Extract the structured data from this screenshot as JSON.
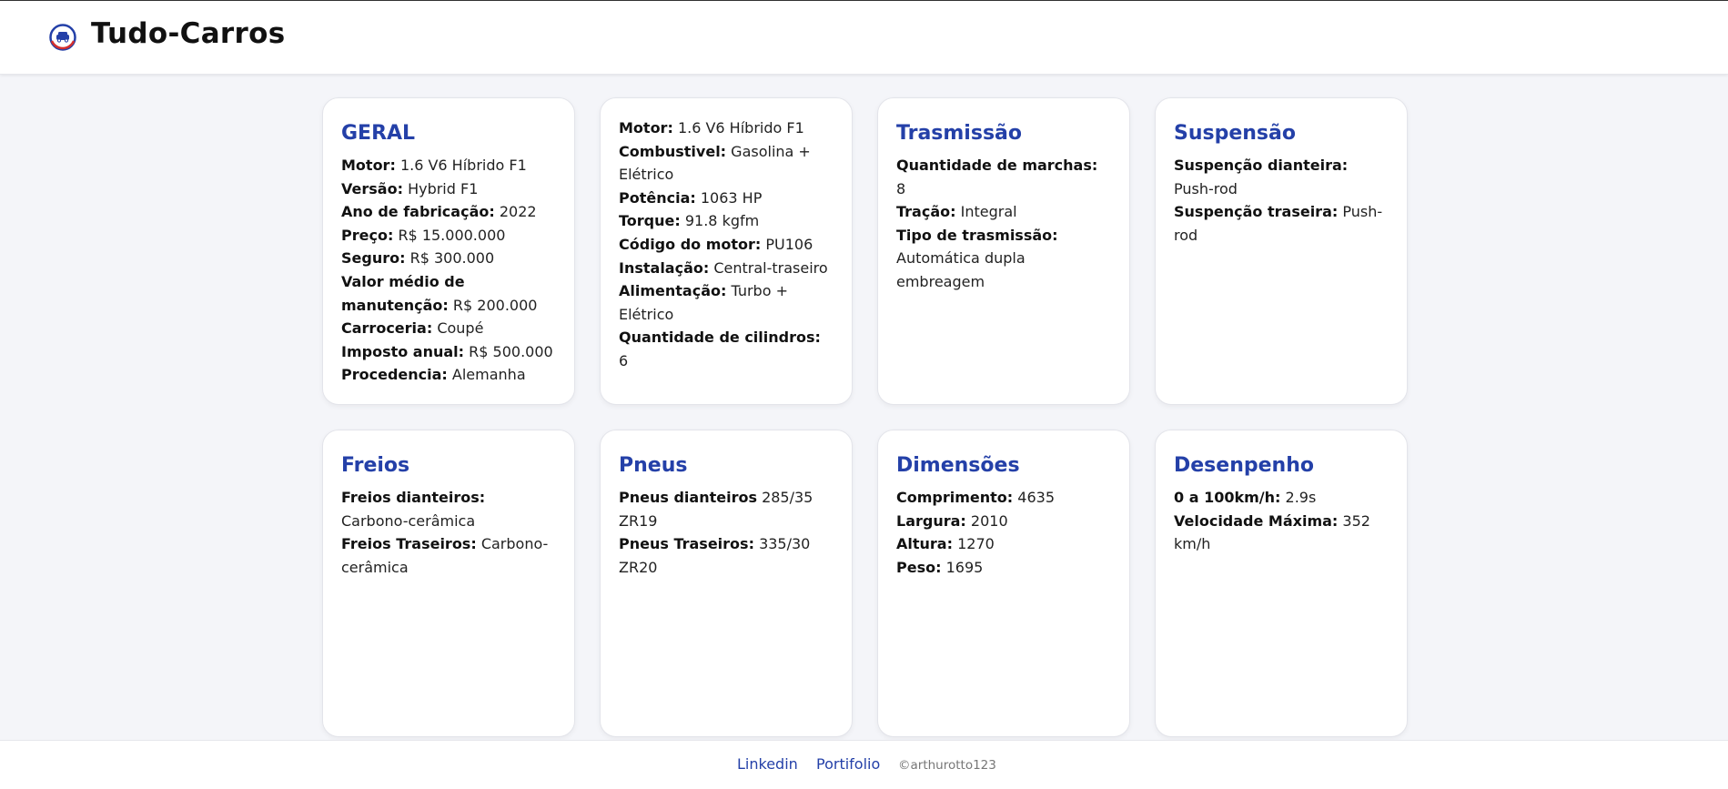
{
  "header": {
    "brand": "Tudo-Carros",
    "logo_icon": "car-logo-icon"
  },
  "cards": {
    "geral": {
      "title": "GERAL",
      "rows": [
        {
          "label": "Motor:",
          "value": "1.6 V6 Híbrido F1"
        },
        {
          "label": "Versão:",
          "value": "Hybrid F1"
        },
        {
          "label": "Ano de fabricação:",
          "value": "2022"
        },
        {
          "label": "Preço:",
          "value": "R$ 15.000.000"
        },
        {
          "label": "Seguro:",
          "value": "R$ 300.000"
        },
        {
          "label": "Valor médio de manutenção:",
          "value": "R$ 200.000"
        },
        {
          "label": "Carroceria:",
          "value": "Coupé"
        },
        {
          "label": "Imposto anual:",
          "value": "R$ 500.000"
        },
        {
          "label": "Procedencia:",
          "value": "Alemanha"
        }
      ]
    },
    "motor": {
      "rows": [
        {
          "label": "Motor:",
          "value": "1.6 V6 Híbrido F1"
        },
        {
          "label": "Combustivel:",
          "value": "Gasolina + Elétrico"
        },
        {
          "label": "Potência:",
          "value": "1063 HP"
        },
        {
          "label": "Torque:",
          "value": "91.8 kgfm"
        },
        {
          "label": "Código do motor:",
          "value": "PU106"
        },
        {
          "label": "Instalação:",
          "value": "Central-traseiro"
        },
        {
          "label": "Alimentação:",
          "value": "Turbo + Elétrico"
        },
        {
          "label": "Quantidade de cilindros:",
          "value": "6"
        }
      ]
    },
    "transmissao": {
      "title": "Trasmissão",
      "rows": [
        {
          "label": "Quantidade de marchas:",
          "value": "8"
        },
        {
          "label": "Tração:",
          "value": "Integral"
        },
        {
          "label": "Tipo de trasmissão:",
          "value": "Automática dupla embreagem"
        }
      ]
    },
    "suspensao": {
      "title": "Suspensão",
      "rows": [
        {
          "label": "Suspenção dianteira:",
          "value": "Push-rod"
        },
        {
          "label": "Suspenção traseira:",
          "value": "Push-rod"
        }
      ]
    },
    "freios": {
      "title": "Freios",
      "rows": [
        {
          "label": "Freios dianteiros:",
          "value": "Carbono-cerâmica"
        },
        {
          "label": "Freios Traseiros:",
          "value": "Carbono-cerâmica"
        }
      ]
    },
    "pneus": {
      "title": "Pneus",
      "rows": [
        {
          "label": "Pneus dianteiros",
          "value": "285/35 ZR19"
        },
        {
          "label": "Pneus Traseiros:",
          "value": "335/30 ZR20"
        }
      ]
    },
    "dimensoes": {
      "title": "Dimensões",
      "rows": [
        {
          "label": "Comprimento:",
          "value": "4635"
        },
        {
          "label": "Largura:",
          "value": "2010"
        },
        {
          "label": "Altura:",
          "value": "1270"
        },
        {
          "label": "Peso:",
          "value": "1695"
        }
      ]
    },
    "desempenho": {
      "title": "Desenpenho",
      "rows": [
        {
          "label": "0 a 100km/h:",
          "value": "2.9s"
        },
        {
          "label": "Velocidade Máxima:",
          "value": "352 km/h"
        }
      ]
    }
  },
  "footer": {
    "linkedin": "Linkedin",
    "portfolio": "Portifolio",
    "copyright": "©arthurotto123"
  },
  "colors": {
    "accent": "#2440a8",
    "background": "#f4f5f9"
  }
}
